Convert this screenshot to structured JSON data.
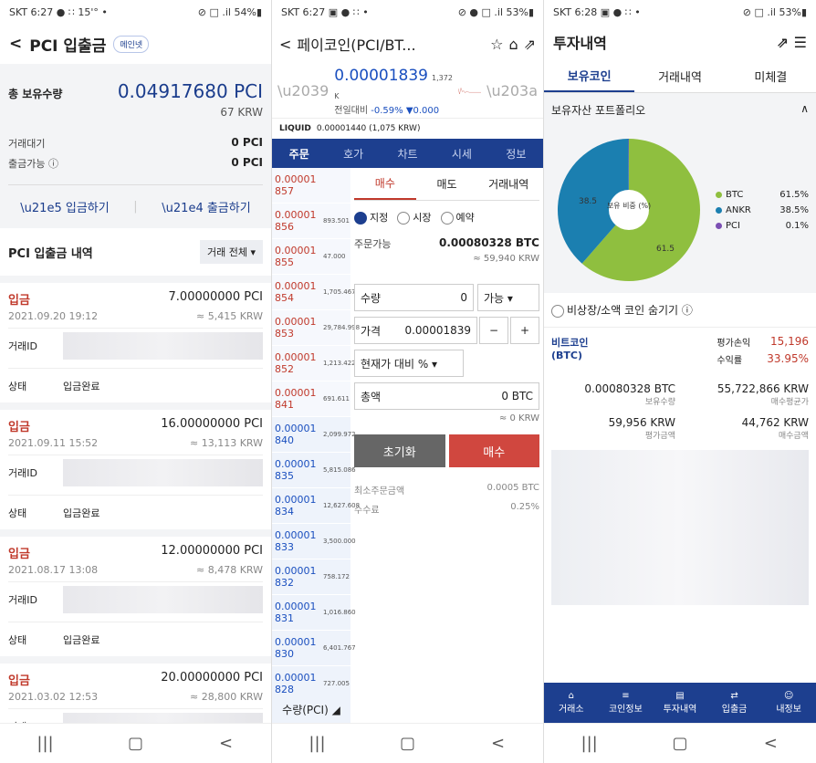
{
  "p1": {
    "status": {
      "left": "SKT 6:27 ● ∷ 15'° •",
      "right": "⊘ □ .il 54%▮"
    },
    "header": {
      "back": "<",
      "title": "PCI 입출금",
      "badge": "메인넷"
    },
    "holdings": {
      "label": "총 보유수량",
      "value": "0.04917680 PCI",
      "krw": "67 KRW",
      "rows": [
        {
          "k": "거래대기",
          "v": "0 PCI"
        },
        {
          "k": "출금가능 ⓘ",
          "v": "0 PCI"
        }
      ]
    },
    "actions": {
      "deposit": "입금하기",
      "withdraw": "출금하기"
    },
    "history": {
      "title": "PCI 입출금 내역",
      "filter": "거래 전체 ▾",
      "items": [
        {
          "type": "입금",
          "amount": "7.00000000 PCI",
          "date": "2021.09.20 19:12",
          "krw": "≈ 5,415 KRW",
          "txid_label": "거래ID",
          "status_label": "상태",
          "status": "입금완료"
        },
        {
          "type": "입금",
          "amount": "16.00000000 PCI",
          "date": "2021.09.11 15:52",
          "krw": "≈ 13,113 KRW",
          "txid_label": "거래ID",
          "status_label": "상태",
          "status": "입금완료"
        },
        {
          "type": "입금",
          "amount": "12.00000000 PCI",
          "date": "2021.08.17 13:08",
          "krw": "≈ 8,478 KRW",
          "txid_label": "거래ID",
          "status_label": "상태",
          "status": "입금완료"
        },
        {
          "type": "입금",
          "amount": "20.00000000 PCI",
          "date": "2021.03.02 12:53",
          "krw": "≈ 28,800 KRW",
          "txid_label": "거래ID",
          "status_label": "상태",
          "status": "입금완료"
        }
      ]
    }
  },
  "p2": {
    "status": {
      "left": "SKT 6:27 ▣ ● ∷ •",
      "right": "⊘ ● □ .il 53%▮"
    },
    "header": {
      "back": "<",
      "title": "페이코인(PCI/BT...",
      "star": "☆",
      "bell": "⌂",
      "share": "⇗"
    },
    "price": {
      "value": "0.00001839",
      "vol": "1,372 K",
      "change_label": "전일대비",
      "change_pct": "-0.59%",
      "change_abs": "▼0.000"
    },
    "liquid": {
      "label": "LIQUID",
      "value": "0.00001440 (1,075 KRW)"
    },
    "tabs": [
      "주문",
      "호가",
      "차트",
      "시세",
      "정보"
    ],
    "orderbook": [
      {
        "price": "0.00001\n857",
        "qty": ""
      },
      {
        "price": "0.00001\n856",
        "qty": "893.501"
      },
      {
        "price": "0.00001\n855",
        "qty": "47.000"
      },
      {
        "price": "0.00001\n854",
        "qty": "1,705.467"
      },
      {
        "price": "0.00001\n853",
        "qty": "29,784.998"
      },
      {
        "price": "0.00001\n852",
        "qty": "1,213.422"
      },
      {
        "price": "0.00001\n841",
        "qty": "691.611"
      },
      {
        "price": "0.00001\n840",
        "qty": "2,099.972"
      },
      {
        "price": "0.00001\n835",
        "qty": "5,815.086"
      },
      {
        "price": "0.00001\n834",
        "qty": "12,627.608"
      },
      {
        "price": "0.00001\n833",
        "qty": "3,500.000"
      },
      {
        "price": "0.00001\n832",
        "qty": "758.172"
      },
      {
        "price": "0.00001\n831",
        "qty": "1,016.860"
      },
      {
        "price": "0.00001\n830",
        "qty": "6,401.767"
      },
      {
        "price": "0.00001\n828",
        "qty": "727.005"
      },
      {
        "price": "0.00001",
        "qty": ""
      }
    ],
    "order": {
      "subtabs": [
        "매수",
        "매도",
        "거래내역"
      ],
      "radio": [
        "지정",
        "시장",
        "예약"
      ],
      "avail_label": "주문가능",
      "avail": "0.00080328 BTC",
      "avail_krw": "≈ 59,940 KRW",
      "qty_label": "수량",
      "qty": "0",
      "qty_opt": "가능 ▾",
      "price_label": "가격",
      "price": "0.00001839",
      "minus": "−",
      "plus": "+",
      "pct": "현재가 대비 % ▾",
      "total_label": "총액",
      "total": "0 BTC",
      "total_krw": "≈ 0 KRW",
      "reset": "초기화",
      "buy": "매수",
      "min_label": "최소주문금액",
      "min": "0.0005 BTC",
      "fee_label": "수수료",
      "fee": "0.25%"
    },
    "qty_bar": "수량(PCI) ◢"
  },
  "p3": {
    "status": {
      "left": "SKT 6:28 ▣ ● ∷ •",
      "right": "⊘ □ .il 53%▮"
    },
    "header": {
      "title": "투자내역",
      "share": "⇗",
      "chat": "☰"
    },
    "tabs": [
      "보유코인",
      "거래내역",
      "미체결"
    ],
    "portfolio": {
      "title": "보유자산 포트폴리오",
      "collapse": "∧",
      "center": "보유 비중\n(%)",
      "btc_label_in": "61.5",
      "ankr_label_in": "38.5"
    },
    "legend": [
      {
        "name": "BTC",
        "pct": "61.5%",
        "color": "#8fbf3f"
      },
      {
        "name": "ANKR",
        "pct": "38.5%",
        "color": "#1b7fb0"
      },
      {
        "name": "PCI",
        "pct": "0.1%",
        "color": "#7b4fb3"
      }
    ],
    "chart_data": {
      "type": "pie",
      "categories": [
        "BTC",
        "ANKR",
        "PCI"
      ],
      "values": [
        61.5,
        38.5,
        0.1
      ],
      "title": "보유자산 포트폴리오"
    },
    "hide": "비상장/소액 코인 숨기기 ⓘ",
    "coin": {
      "name": "비트코인\n(BTC)",
      "pl_label": "평가손익",
      "pl": "15,196",
      "rate_label": "수익률",
      "rate": "33.95%"
    },
    "grid": [
      {
        "v": "0.00080328 BTC",
        "k": "보유수량"
      },
      {
        "v": "55,722,866 KRW",
        "k": "매수평균가"
      },
      {
        "v": "59,956 KRW",
        "k": "평가금액"
      },
      {
        "v": "44,762 KRW",
        "k": "매수금액"
      }
    ],
    "bottom": [
      "거래소",
      "코인정보",
      "투자내역",
      "입출금",
      "내정보"
    ]
  },
  "nav": {
    "recent": "|||",
    "home": "▢",
    "back": "<"
  }
}
